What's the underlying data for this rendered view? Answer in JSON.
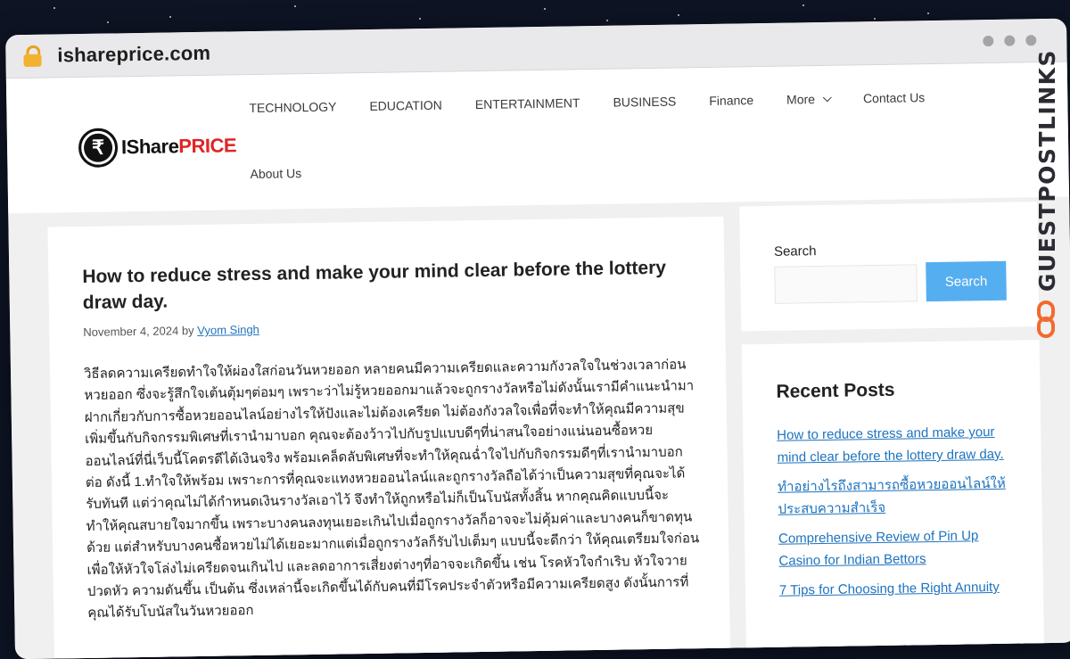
{
  "browser": {
    "url": "ishareprice.com",
    "lock_icon": "lock-icon",
    "window_controls": [
      "dot",
      "dot",
      "dot"
    ]
  },
  "logo": {
    "mark": "₹",
    "text_prefix": "IShare",
    "text_suffix": "PRICE"
  },
  "nav": {
    "row1": [
      {
        "label": "TECHNOLOGY"
      },
      {
        "label": "EDUCATION"
      },
      {
        "label": "ENTERTAINMENT"
      },
      {
        "label": "BUSINESS"
      },
      {
        "label": "Finance"
      },
      {
        "label": "More"
      },
      {
        "label": "Contact Us"
      }
    ],
    "row2": [
      {
        "label": "About Us"
      }
    ]
  },
  "article": {
    "title": "How to reduce stress and make your mind clear before the lottery draw day.",
    "date": "November 4, 2024",
    "by": "by",
    "author": "Vyom Singh",
    "body": "วิธีลดความเครียดทำใจให้ผ่องใสก่อนวันหวยออก หลายคนมีความเครียดและความกังวลใจในช่วงเวลาก่อนหวยออก ซึ่งจะรู้สึกใจเต้นตุ้มๆต่อมๆ เพราะว่าไม่รู้หวยออกมาแล้วจะถูกรางวัลหรือไม่ดังนั้นเรามีคำแนะนำมาฝากเกี่ยวกับการซื้อหวยออนไลน์อย่างไรให้ปังและไม่ต้องเครียด ไม่ต้องกังวลใจเพื่อที่จะทำให้คุณมีความสุขเพิ่มขึ้นกับกิจกรรมพิเศษที่เรานำมาบอก คุณจะต้องว้าวไปกับรูปแบบดีๆที่น่าสนใจอย่างแน่นอนซื้อหวยออนไลน์ที่นี่เว็บนี้โคตรดีได้เงินจริง พร้อมเคล็ดลับพิเศษที่จะทำให้คุณฉ่ำใจไปกับกิจกรรมดีๆที่เรานำมาบอกต่อ ดังนี้ 1.ทำใจให้พร้อม เพราะการที่คุณจะแทงหวยออนไลน์และถูกรางวัลถือได้ว่าเป็นความสุขที่คุณจะได้รับทันที แต่ว่าคุณไม่ได้กำหนดเงินรางวัลเอาไว้ จึงทำให้ถูกหรือไม่ก็เป็นโบนัสทั้งสิ้น หากคุณคิดแบบนี้จะทำให้คุณสบายใจมากขึ้น เพราะบางคนลงทุนเยอะเกินไปเมื่อถูกรางวัลก็อาจจะไม่คุ้มค่าและบางคนก็ขาดทุนด้วย แต่สำหรับบางคนซื้อหวยไม่ได้เยอะมากแต่เมื่อถูกรางวัลก็รับไปเต็มๆ แบบนี้จะดีกว่า ให้คุณเตรียมใจก่อนเพื่อให้หัวใจโล่งไม่เครียดจนเกินไป และลดอาการเสี่ยงต่างๆที่อาจจะเกิดขึ้น เช่น โรคหัวใจกำเริบ หัวใจวาย ปวดหัว ความดันขึ้น เป็นต้น ซึ่งเหล่านี้จะเกิดขึ้นได้กับคนที่มีโรคประจำตัวหรือมีความเครียดสูง ดังนั้นการที่คุณได้รับโบนัสในวันหวยออก"
  },
  "sidebar": {
    "search": {
      "label": "Search",
      "button": "Search",
      "value": ""
    },
    "recent": {
      "title": "Recent Posts",
      "items": [
        "How to reduce stress and make your mind clear before the lottery draw day.",
        "ทำอย่างไรถึงสามารถซื้อหวยออนไลน์ให้ประสบความสำเร็จ",
        "Comprehensive Review of Pin Up Casino for Indian Bettors",
        "7 Tips for Choosing the Right Annuity"
      ]
    }
  },
  "badge": {
    "text": "GUESTPOSTLINKS",
    "icon": "chain-link-icon",
    "color": "#f26a2e"
  }
}
